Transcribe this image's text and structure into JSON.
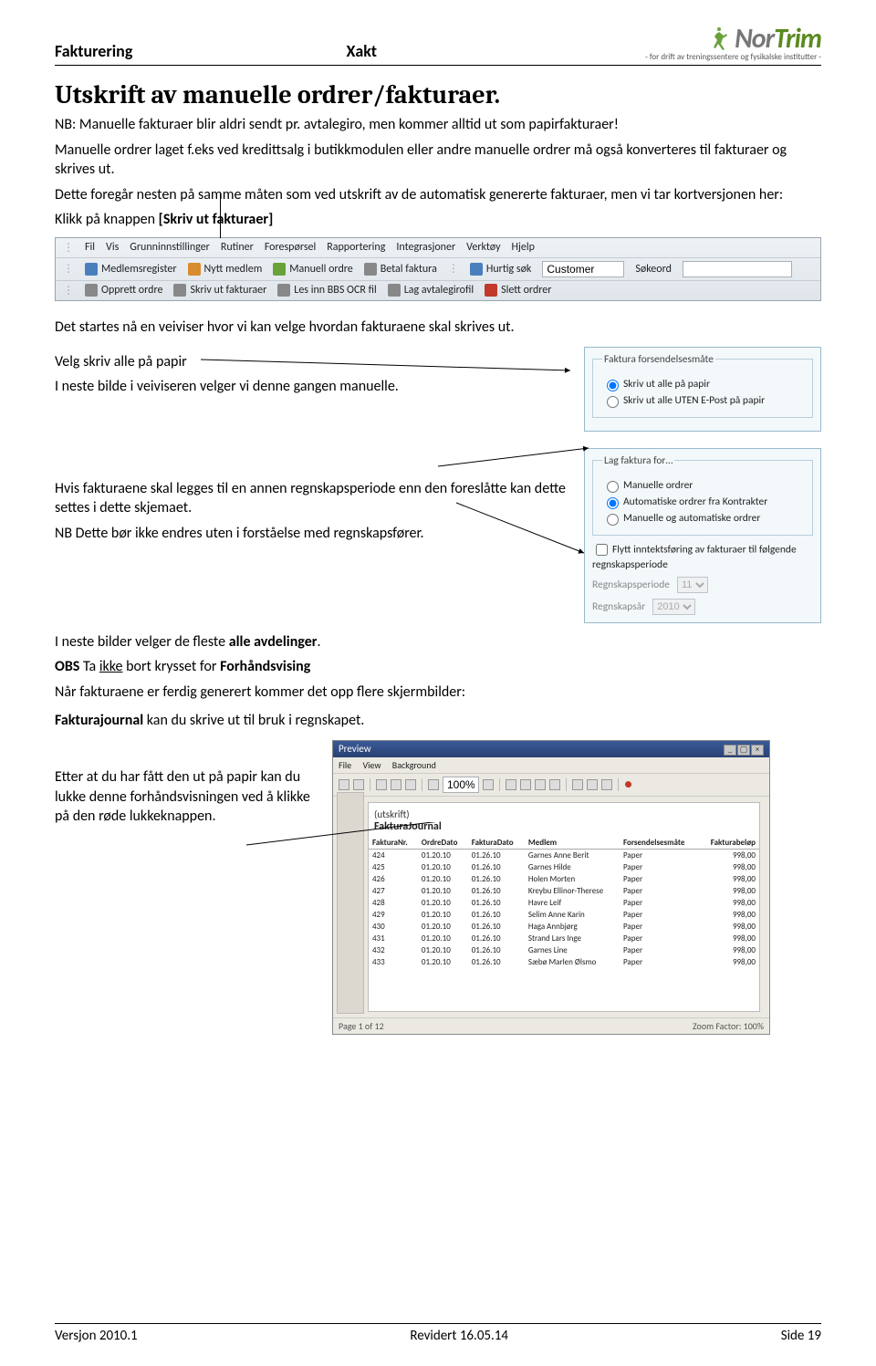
{
  "header": {
    "left": "Fakturering",
    "center": "Xakt"
  },
  "logo": {
    "brand_prefix": "Nor",
    "brand_suffix": "Trim",
    "tagline": "- for drift av treningssentere og fysikalske institutter -"
  },
  "title": "Utskrift av manuelle ordrer/fakturaer.",
  "p1": "NB: Manuelle fakturaer blir aldri sendt pr. avtalegiro, men kommer alltid ut som papirfakturaer!",
  "p2": "Manuelle ordrer laget f.eks ved kredittsalg i butikkmodulen eller andre manuelle ordrer må også konverteres til fakturaer og skrives ut.",
  "p3": "Dette foregår nesten på samme måten som ved utskrift av de automatisk genererte fakturaer, men vi tar kortversjonen her:",
  "p4_prefix": "Klikk på knappen ",
  "p4_bold": "[Skriv ut fakturaer]",
  "menu": {
    "items": [
      "Fil",
      "Vis",
      "Grunninnstillinger",
      "Rutiner",
      "Forespørsel",
      "Rapportering",
      "Integrasjoner",
      "Verktøy",
      "Hjelp"
    ]
  },
  "toolbar_row2": {
    "items": [
      "Medlemsregister",
      "Nytt medlem",
      "Manuell ordre",
      "Betal faktura"
    ],
    "hurtig_label": "Hurtig søk",
    "hurtig_value": "Customer",
    "sokeord_label": "Søkeord"
  },
  "toolbar_row3": {
    "items": [
      "Opprett ordre",
      "Skriv ut fakturaer",
      "Les inn BBS OCR fil",
      "Lag avtalegirofil",
      "Slett ordrer"
    ]
  },
  "p5": "Det startes nå en veiviser hvor vi kan velge hvordan fakturaene skal skrives ut.",
  "p6": "Velg  skriv alle på papir",
  "p7": "I neste bilde i veiviseren velger vi denne gangen manuelle.",
  "panel1": {
    "legend": "Faktura forsendelsesmåte",
    "opt1": "Skriv ut alle på papir",
    "opt2": "Skriv ut alle UTEN E-Post på papir"
  },
  "panel2": {
    "legend": "Lag faktura for…",
    "opt1": "Manuelle ordrer",
    "opt2": "Automatiske ordrer fra Kontrakter",
    "opt3": "Manuelle og automatiske ordrer",
    "chk": "Flytt inntektsføring av fakturaer til følgende regnskapsperiode",
    "regper_label": "Regnskapsperiode",
    "regper_value": "11",
    "regar_label": "Regnskapsår",
    "regar_value": "2010"
  },
  "p8": "Hvis fakturaene skal legges til en annen regnskapsperiode enn den foreslåtte kan dette settes i dette skjemaet.",
  "p9": "NB Dette bør ikke endres uten i forståelse med regnskapsfører.",
  "p10_a": "I neste bilder velger de fleste  ",
  "p10_b": "alle avdelinger",
  "p10_c": ".",
  "p11_a": "OBS",
  "p11_b": " Ta ",
  "p11_c": "ikke",
  "p11_d": " bort krysset for  ",
  "p11_e": "Forhåndsvising",
  "p12": "Når fakturaene er ferdig generert kommer det opp flere skjermbilder:",
  "p13_a": "Fakturajournal",
  "p13_b": " kan du skrive ut til bruk i regnskapet.",
  "p14": "Etter at du har fått den ut på papir kan du lukke denne forhåndsvisningen ved å klikke på den røde lukkeknappen.",
  "preview": {
    "app_title": "Preview",
    "menu": [
      "File",
      "View",
      "Background"
    ],
    "zoom": "100%",
    "report_sub": "(utskrift)",
    "report_title": "FakturaJournal",
    "columns": [
      "FakturaNr.",
      "OrdreDato",
      "FakturaDato",
      "Medlem",
      "Forsendelsesmåte",
      "Fakturabeløp"
    ],
    "rows": [
      {
        "nr": "424",
        "od": "01.20.10",
        "fd": "01.26.10",
        "m": "Garnes Anne Berit",
        "f": "Paper",
        "b": "998,00"
      },
      {
        "nr": "425",
        "od": "01.20.10",
        "fd": "01.26.10",
        "m": "Garnes Hilde",
        "f": "Paper",
        "b": "998,00"
      },
      {
        "nr": "426",
        "od": "01.20.10",
        "fd": "01.26.10",
        "m": "Holen Morten",
        "f": "Paper",
        "b": "998,00"
      },
      {
        "nr": "427",
        "od": "01.20.10",
        "fd": "01.26.10",
        "m": "Kreybu Ellinor-Therese",
        "f": "Paper",
        "b": "998,00"
      },
      {
        "nr": "428",
        "od": "01.20.10",
        "fd": "01.26.10",
        "m": "Havre Leif",
        "f": "Paper",
        "b": "998,00"
      },
      {
        "nr": "429",
        "od": "01.20.10",
        "fd": "01.26.10",
        "m": "Selim Anne Karin",
        "f": "Paper",
        "b": "998,00"
      },
      {
        "nr": "430",
        "od": "01.20.10",
        "fd": "01.26.10",
        "m": "Haga Annbjørg",
        "f": "Paper",
        "b": "998,00"
      },
      {
        "nr": "431",
        "od": "01.20.10",
        "fd": "01.26.10",
        "m": "Strand Lars Inge",
        "f": "Paper",
        "b": "998,00"
      },
      {
        "nr": "432",
        "od": "01.20.10",
        "fd": "01.26.10",
        "m": "Garnes Line",
        "f": "Paper",
        "b": "998,00"
      },
      {
        "nr": "433",
        "od": "01.20.10",
        "fd": "01.26.10",
        "m": "Sæbø Marlen Ølsmo",
        "f": "Paper",
        "b": "998,00"
      }
    ],
    "status_left": "Page 1 of 12",
    "status_right": "Zoom Factor: 100%"
  },
  "footer": {
    "left": "Versjon 2010.1",
    "center": "Revidert 16.05.14",
    "right": "Side 19"
  }
}
